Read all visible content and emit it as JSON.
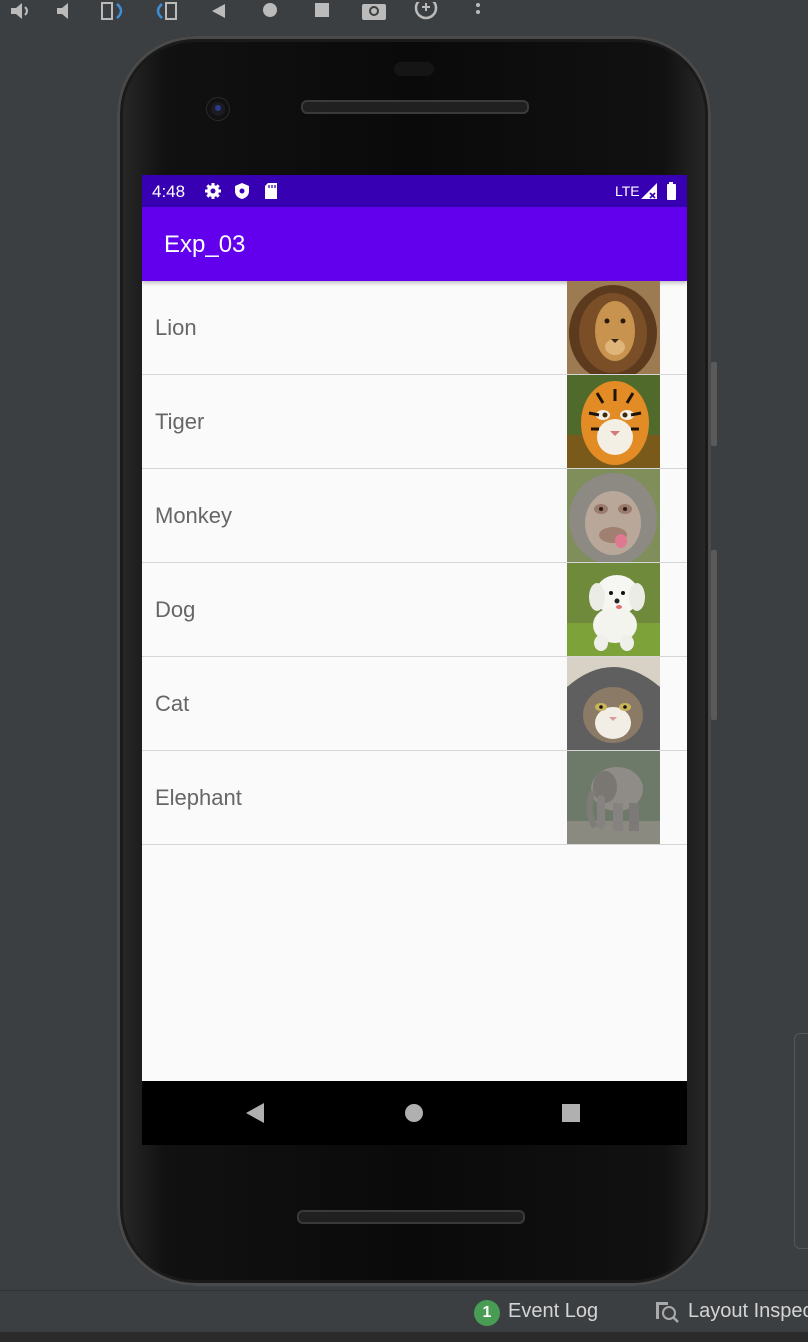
{
  "emulator_toolbar": {
    "icons": [
      "volume-up-icon",
      "volume-down-icon",
      "rotate-left-icon",
      "rotate-right-icon",
      "back-icon",
      "home-icon",
      "overview-icon",
      "screenshot-icon",
      "zoom-icon",
      "more-icon"
    ]
  },
  "status_bar": {
    "time": "4:48",
    "icons": [
      "settings-icon",
      "shield-icon",
      "sd-card-icon"
    ],
    "network": "LTE",
    "right_icons": [
      "signal-icon",
      "battery-icon"
    ]
  },
  "app_bar": {
    "title": "Exp_03",
    "color": "#6200ee",
    "status_color": "#3700b3"
  },
  "animals": [
    {
      "name": "Lion",
      "image": "lion-image"
    },
    {
      "name": "Tiger",
      "image": "tiger-image"
    },
    {
      "name": "Monkey",
      "image": "monkey-image"
    },
    {
      "name": "Dog",
      "image": "dog-image"
    },
    {
      "name": "Cat",
      "image": "cat-image"
    },
    {
      "name": "Elephant",
      "image": "elephant-image"
    }
  ],
  "nav_bar": {
    "icons": [
      "back-triangle-icon",
      "home-circle-icon",
      "recents-square-icon"
    ]
  },
  "ide_status": {
    "event_badge": "1",
    "event_log": "Event Log",
    "layout_inspector": "Layout Inspector"
  }
}
